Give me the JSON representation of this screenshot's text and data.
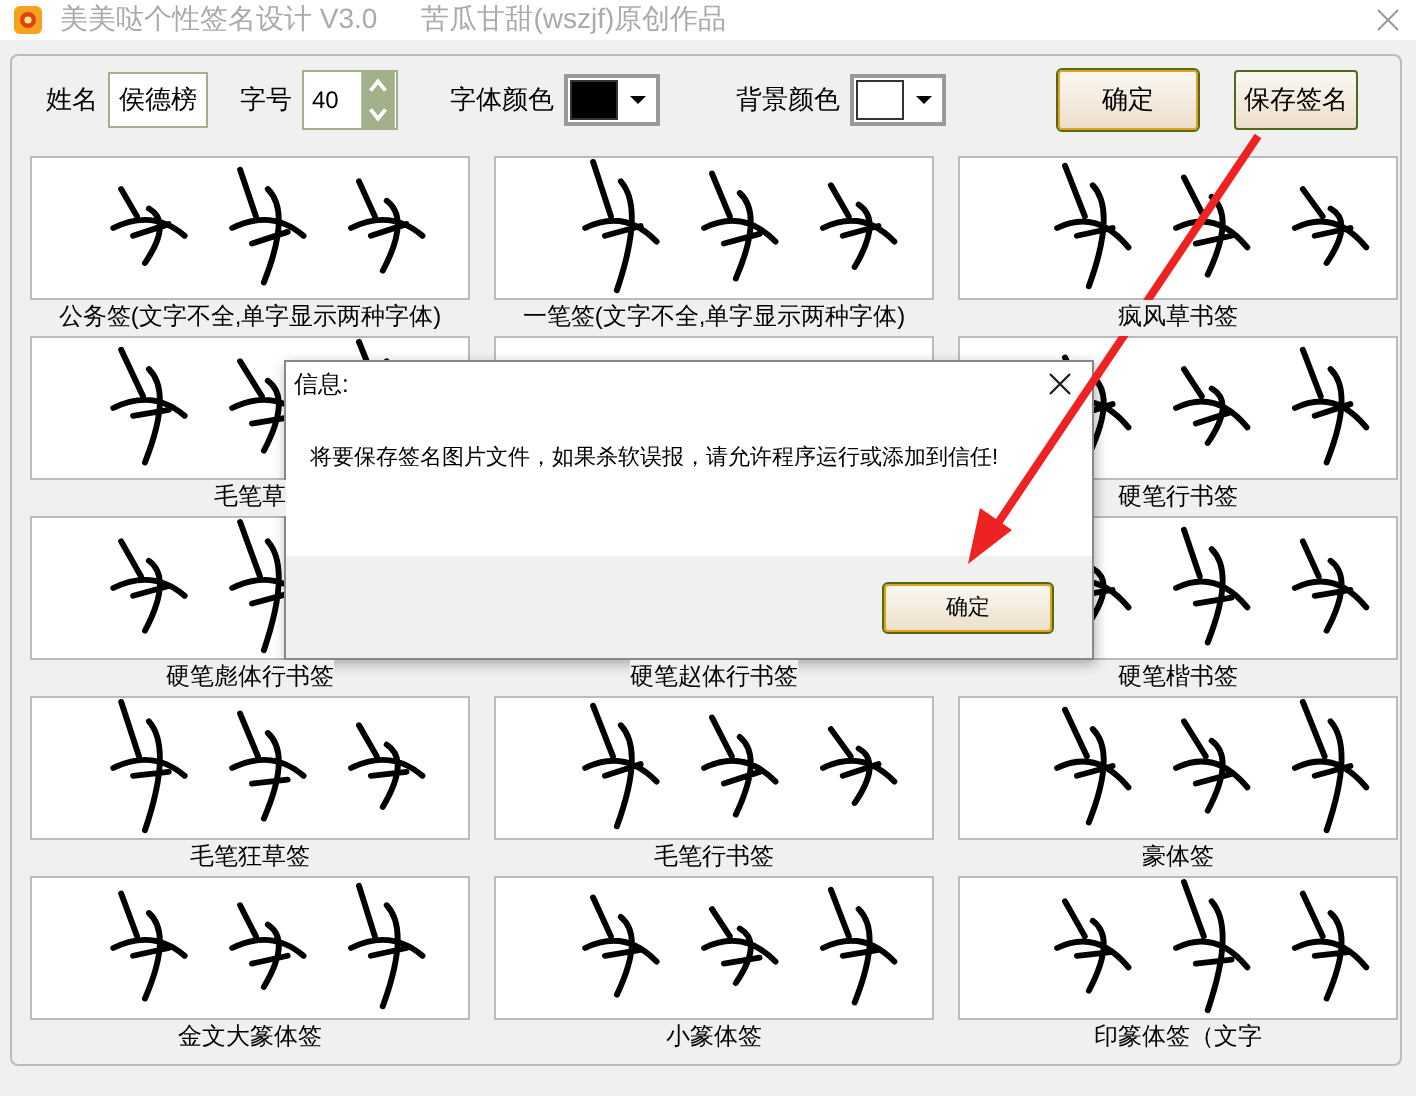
{
  "window": {
    "title": "美美哒个性签名设计 V3.0",
    "author": "苦瓜甘甜(wszjf)原创作品"
  },
  "toolbar": {
    "name_label": "姓名",
    "name_value": "侯德榜",
    "size_label": "字号",
    "size_value": "40",
    "color_pickers": [
      {
        "label": "字体颜色",
        "color": "#000000"
      },
      {
        "label": "背景颜色",
        "color": "#ffffff"
      }
    ],
    "buttons": [
      {
        "label": "确定",
        "selected": true
      },
      {
        "label": "保存签名",
        "selected": false
      }
    ]
  },
  "signatures": [
    {
      "caption": "公务签(文字不全,单字显示两种字体)"
    },
    {
      "caption": "一笔签(文字不全,单字显示两种字体)"
    },
    {
      "caption": "疯风草书签"
    },
    {
      "caption": "毛笔草"
    },
    {
      "kind": "covered"
    },
    {
      "caption": "硬笔行书签"
    },
    {
      "caption": "硬笔彪体行书签"
    },
    {
      "caption": "硬笔赵体行书签"
    },
    {
      "caption": "硬笔楷书签"
    },
    {
      "caption": "毛笔狂草签"
    },
    {
      "caption": "毛笔行书签"
    },
    {
      "caption": "豪体签"
    },
    {
      "caption": "金文大篆体签"
    },
    {
      "caption": "小篆体签"
    },
    {
      "caption": "印篆体签（文字"
    }
  ],
  "dialog": {
    "title": "信息:",
    "message": "将要保存签名图片文件，如果杀软误报，请允许程序运行或添加到信任!",
    "button": "确定"
  }
}
